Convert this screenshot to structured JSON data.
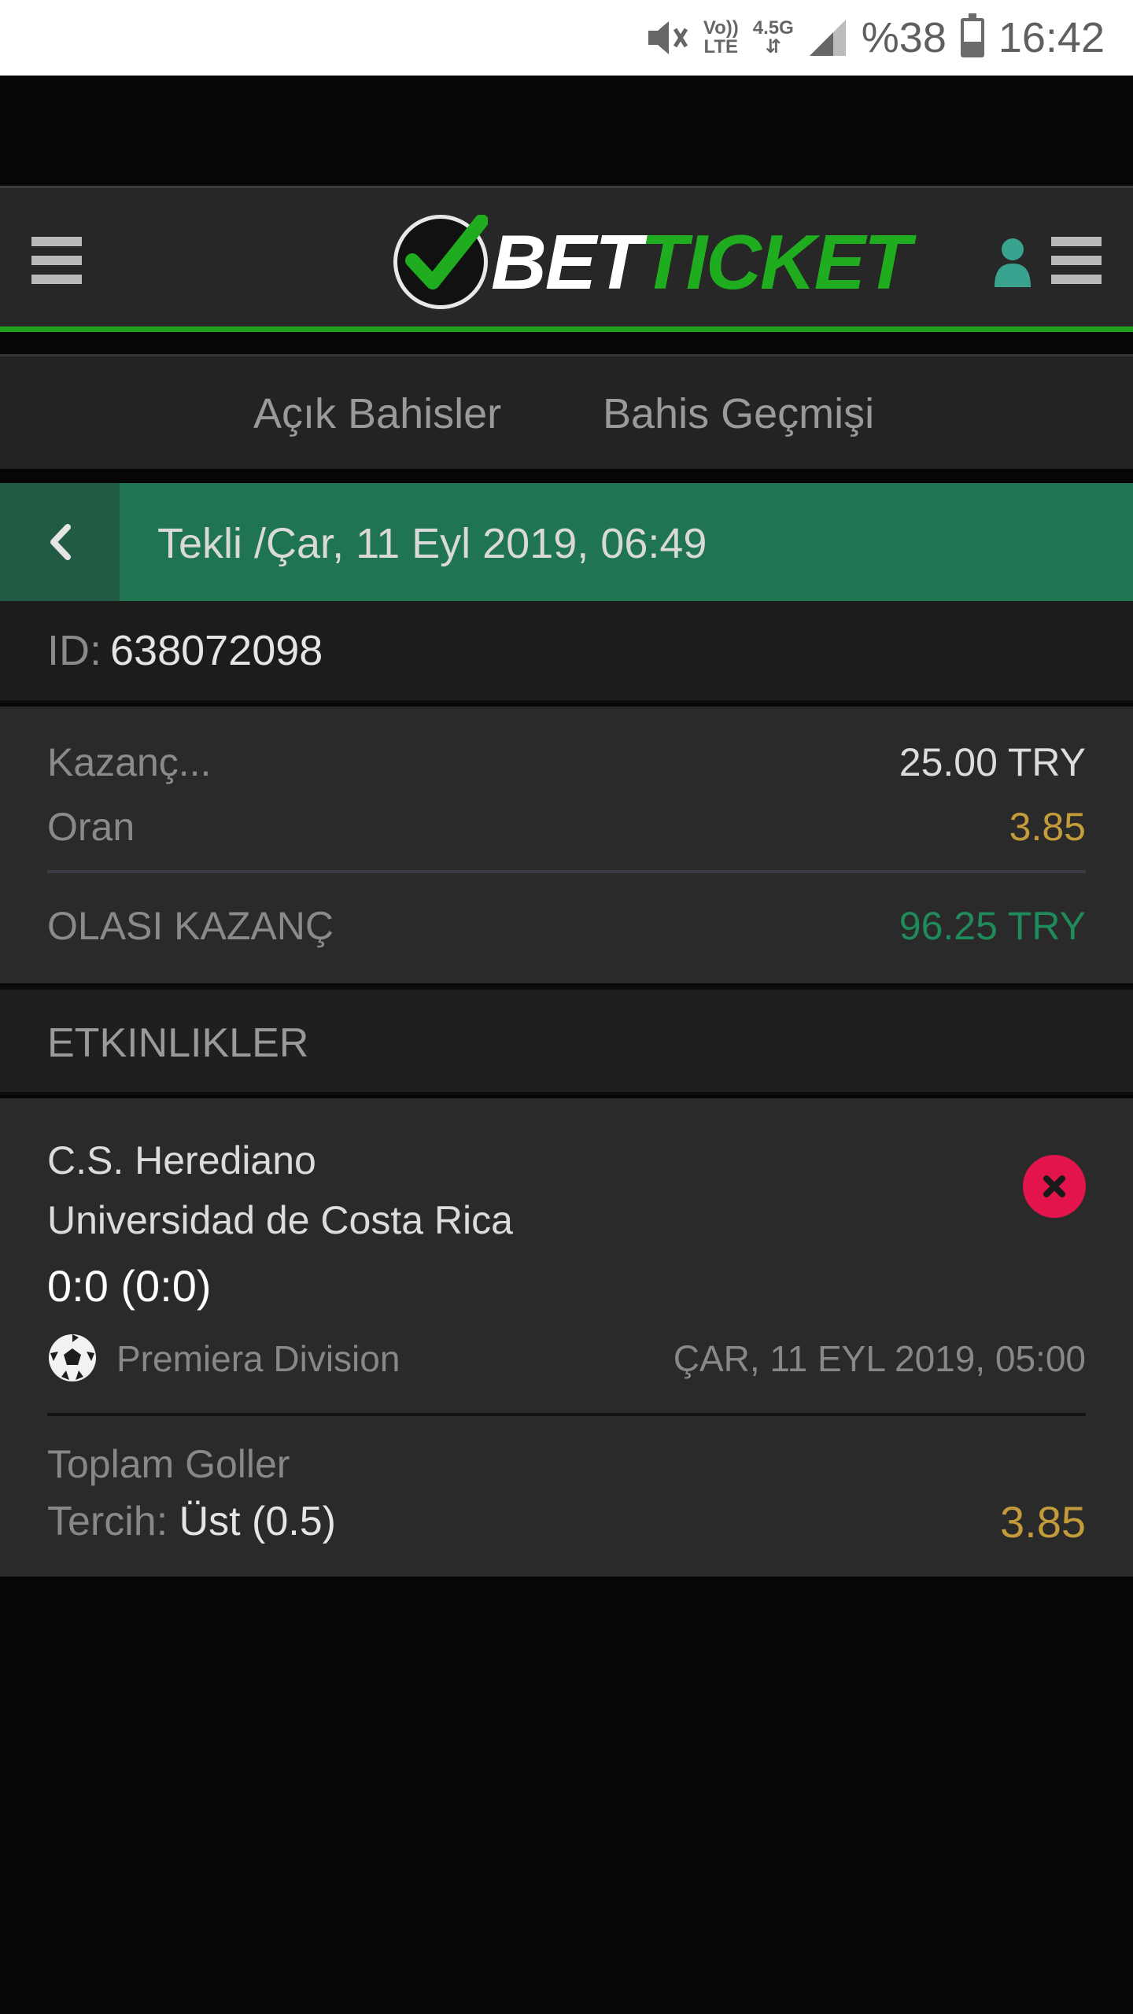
{
  "status_bar": {
    "volte_top": "Vo))",
    "volte_bottom": "LTE",
    "network": "4.5G",
    "battery_percent": "%38",
    "time": "16:42",
    "icons": [
      "mute-icon",
      "signal-icon",
      "battery-icon"
    ]
  },
  "header": {
    "logo_part1": "BET",
    "logo_part2": "TICKET",
    "brand_color": "#1fad1f"
  },
  "tabs": {
    "open_bets": "Açık Bahisler",
    "bet_history": "Bahis Geçmişi"
  },
  "bet": {
    "title": "Tekli /Çar, 11 Eyl 2019, 06:49",
    "id_label": "ID:",
    "id_value": "638072098",
    "stake_label": "Kazanç...",
    "stake_value": "25.00 TRY",
    "odds_label": "Oran",
    "odds_value": "3.85",
    "potential_label": "OLASI KAZANÇ",
    "potential_value": "96.25 TRY"
  },
  "events": {
    "header": "ETKINLIKLER",
    "items": [
      {
        "home_team": "C.S. Herediano",
        "away_team": "Universidad de Costa Rica",
        "score": "0:0 (0:0)",
        "league": "Premiera Division",
        "date": "ÇAR, 11 EYL 2019, 05:00",
        "market": "Toplam Goller",
        "pick_label": "Tercih:",
        "pick_value": "Üst (0.5)",
        "odds": "3.85"
      }
    ]
  },
  "colors": {
    "header_green": "#1f7451",
    "odds_gold": "#c39b3a",
    "win_green": "#1f8a5a",
    "remove_red": "#e3134c"
  }
}
